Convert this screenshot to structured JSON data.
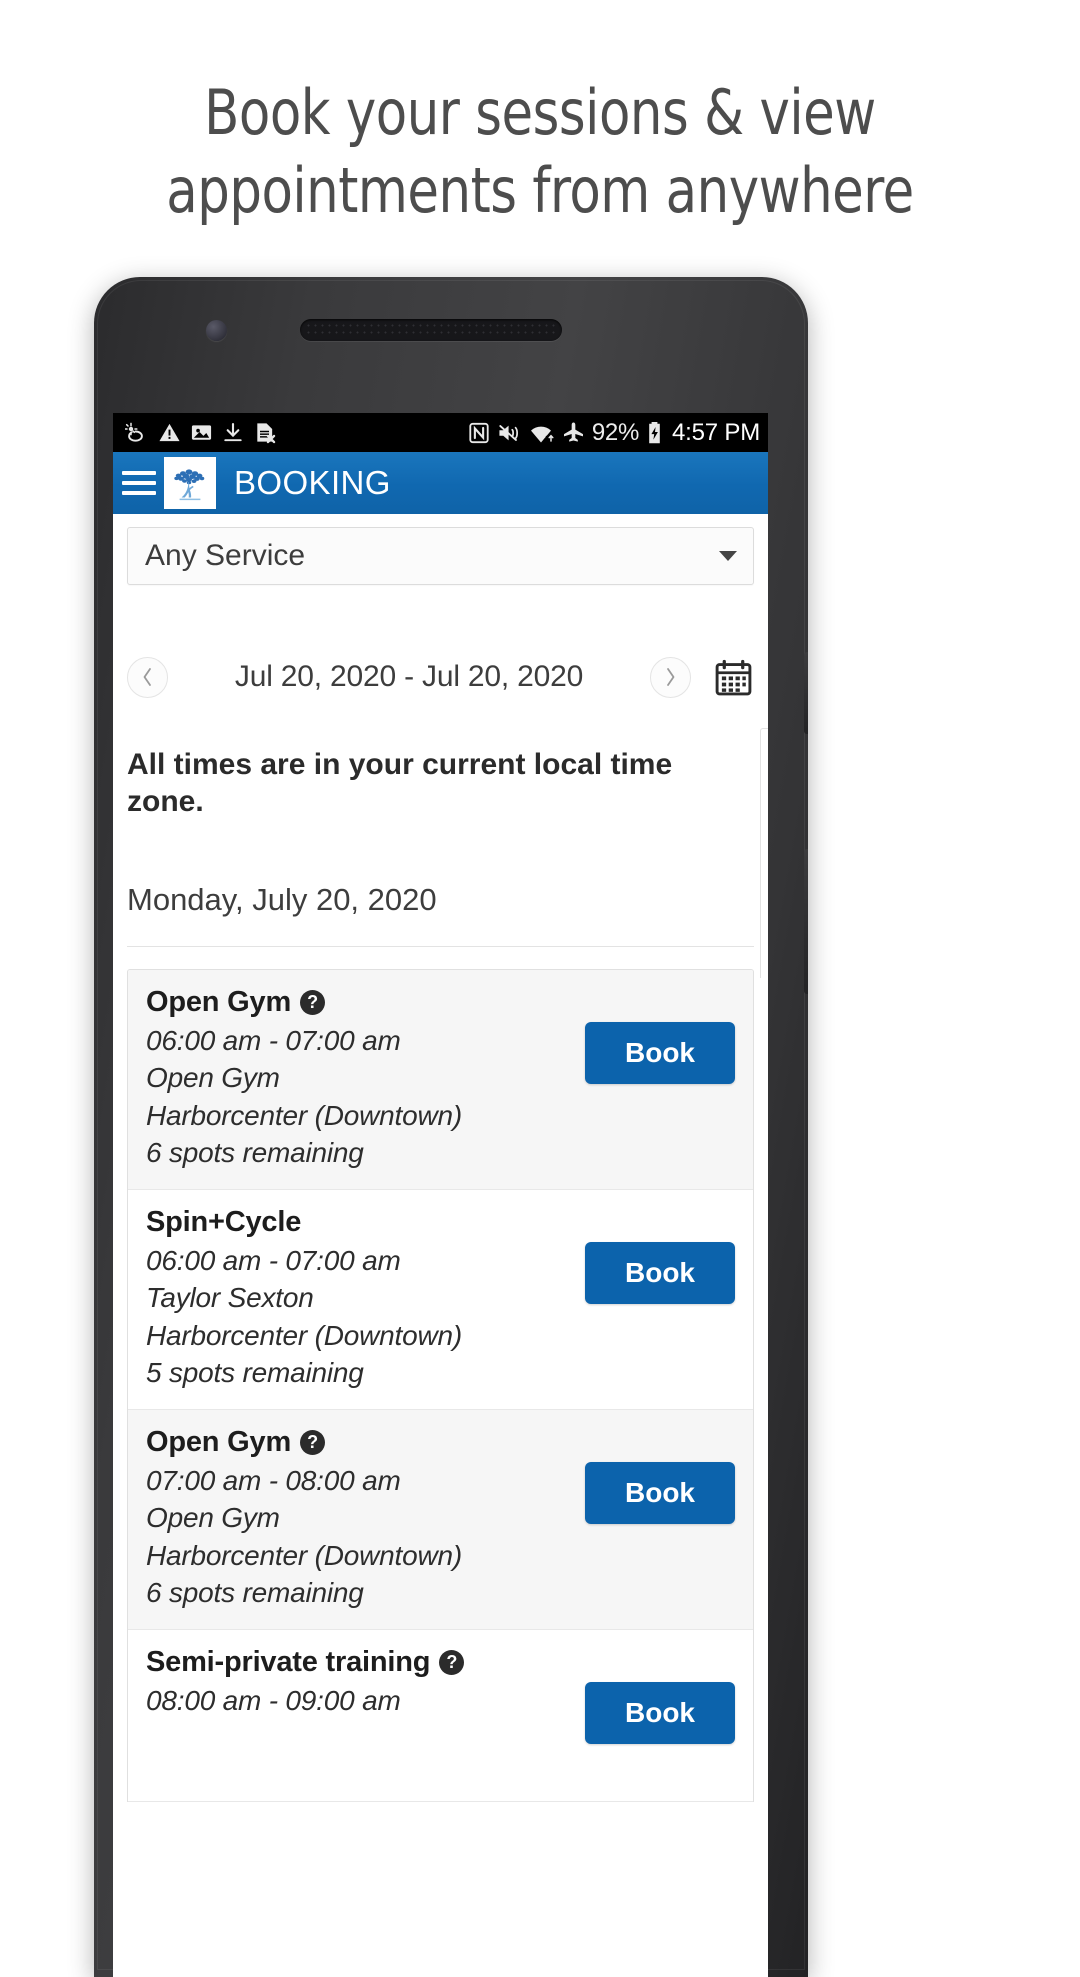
{
  "headline": {
    "line1": "Book your sessions & view",
    "line2": "appointments from anywhere"
  },
  "statusbar": {
    "left_icons": [
      "brightness-auto-icon",
      "warning-icon",
      "image-icon",
      "download-icon",
      "sim-removed-icon"
    ],
    "right_icons": [
      "nfc-icon",
      "vibrate-off-icon",
      "wifi-icon",
      "airplane-mode-icon"
    ],
    "battery_percent": "92%",
    "battery_icon": "battery-charging-icon",
    "time": "4:57 PM"
  },
  "appbar": {
    "menu_icon": "hamburger-menu-icon",
    "logo_icon": "tree-logo-icon",
    "title": "BOOKING",
    "background_color": "#1068b0"
  },
  "service_filter": {
    "value": "Any Service",
    "caret_icon": "chevron-down-icon"
  },
  "date_nav": {
    "prev_icon": "chevron-left-icon",
    "next_icon": "chevron-right-icon",
    "range": "Jul 20, 2020 - Jul 20, 2020",
    "calendar_icon": "calendar-icon"
  },
  "notice": "All times are in your current local time zone.",
  "day_title": "Monday, July 20, 2020",
  "accent_color": "#0c63ac",
  "sessions": [
    {
      "title": "Open Gym",
      "has_info_icon": true,
      "time": "06:00 am - 07:00 am",
      "provider": "Open Gym",
      "location": "Harborcenter (Downtown)",
      "spots": "6 spots remaining",
      "book_label": "Book"
    },
    {
      "title": "Spin+Cycle",
      "has_info_icon": false,
      "time": "06:00 am - 07:00 am",
      "provider": "Taylor Sexton",
      "location": "Harborcenter (Downtown)",
      "spots": "5 spots remaining",
      "book_label": "Book"
    },
    {
      "title": "Open Gym",
      "has_info_icon": true,
      "time": "07:00 am - 08:00 am",
      "provider": "Open Gym",
      "location": "Harborcenter (Downtown)",
      "spots": "6 spots remaining",
      "book_label": "Book"
    },
    {
      "title": "Semi-private training",
      "has_info_icon": true,
      "time": "08:00 am - 09:00 am",
      "provider": "",
      "location": "",
      "spots": "",
      "book_label": "Book"
    }
  ]
}
